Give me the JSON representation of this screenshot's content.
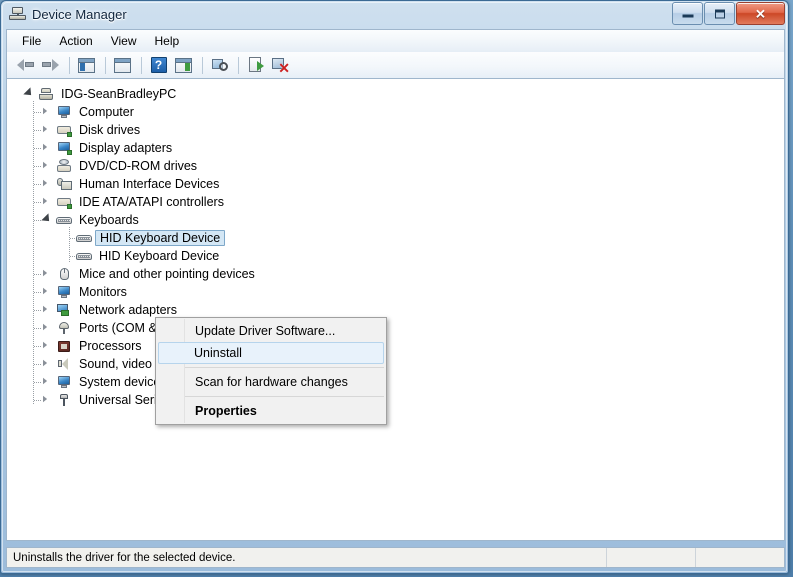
{
  "window": {
    "title": "Device Manager",
    "title_icon": "device-manager-icon",
    "buttons": {
      "minimize": "minimize-icon",
      "maximize": "maximize-icon",
      "close": "✕"
    }
  },
  "menubar": {
    "items": [
      {
        "label": "File"
      },
      {
        "label": "Action"
      },
      {
        "label": "View"
      },
      {
        "label": "Help"
      }
    ]
  },
  "toolbar": {
    "buttons": [
      {
        "name": "back-button",
        "icon": "arrow-left-icon"
      },
      {
        "name": "forward-button",
        "icon": "arrow-right-icon"
      },
      {
        "name": "show-hide-console-tree-button",
        "icon": "console-tree-icon"
      },
      {
        "name": "properties-window-button",
        "icon": "properties-window-icon"
      },
      {
        "name": "help-button",
        "icon": "question-mark-icon"
      },
      {
        "name": "show-hide-action-pane-button",
        "icon": "action-pane-icon"
      },
      {
        "name": "scan-for-hardware-changes-button",
        "icon": "scan-hardware-icon"
      },
      {
        "name": "update-driver-button",
        "icon": "update-driver-icon"
      },
      {
        "name": "uninstall-device-button",
        "icon": "uninstall-device-icon"
      }
    ]
  },
  "tree": {
    "root": {
      "label": "IDG-SeanBradleyPC",
      "icon": "computer-server-icon",
      "state": "expanded"
    },
    "nodes": [
      {
        "label": "Computer",
        "icon": "computer-icon",
        "state": "collapsed",
        "level": 1
      },
      {
        "label": "Disk drives",
        "icon": "disk-drive-icon",
        "state": "collapsed",
        "level": 1
      },
      {
        "label": "Display adapters",
        "icon": "display-adapter-icon",
        "state": "collapsed",
        "level": 1
      },
      {
        "label": "DVD/CD-ROM drives",
        "icon": "dvd-drive-icon",
        "state": "collapsed",
        "level": 1
      },
      {
        "label": "Human Interface Devices",
        "icon": "hid-icon",
        "state": "collapsed",
        "level": 1
      },
      {
        "label": "IDE ATA/ATAPI controllers",
        "icon": "ide-controller-icon",
        "state": "collapsed",
        "level": 1
      },
      {
        "label": "Keyboards",
        "icon": "keyboard-icon",
        "state": "expanded",
        "level": 1
      },
      {
        "label": "HID Keyboard Device",
        "icon": "keyboard-icon",
        "state": "leaf",
        "level": 2,
        "selected": true
      },
      {
        "label": "HID Keyboard Device",
        "icon": "keyboard-icon",
        "state": "leaf",
        "level": 2,
        "truncated": "HID Keybo"
      },
      {
        "label": "Mice and other pointing devices",
        "icon": "mouse-icon",
        "state": "collapsed",
        "level": 1,
        "truncated": "Mice and othe"
      },
      {
        "label": "Monitors",
        "icon": "monitor-icon",
        "state": "collapsed",
        "level": 1
      },
      {
        "label": "Network adapters",
        "icon": "network-adapter-icon",
        "state": "collapsed",
        "level": 1,
        "truncated": "Network adapt"
      },
      {
        "label": "Ports (COM & LPT)",
        "icon": "port-icon",
        "state": "collapsed",
        "level": 1,
        "truncated": "Ports (COM &"
      },
      {
        "label": "Processors",
        "icon": "processor-icon",
        "state": "collapsed",
        "level": 1
      },
      {
        "label": "Sound, video and game controllers",
        "icon": "sound-icon",
        "state": "collapsed",
        "level": 1
      },
      {
        "label": "System devices",
        "icon": "system-device-icon",
        "state": "collapsed",
        "level": 1
      },
      {
        "label": "Universal Serial Bus controllers",
        "icon": "usb-icon",
        "state": "collapsed",
        "level": 1
      }
    ]
  },
  "context_menu": {
    "items": [
      {
        "label": "Update Driver Software...",
        "highlighted": false,
        "bold": false
      },
      {
        "label": "Uninstall",
        "highlighted": true,
        "bold": false
      },
      {
        "label": "Scan for hardware changes",
        "highlighted": false,
        "bold": false
      },
      {
        "label": "Properties",
        "highlighted": false,
        "bold": true
      }
    ]
  },
  "statusbar": {
    "text": "Uninstalls the driver for the selected device."
  },
  "colors": {
    "selection_fill": "#d4e7f5",
    "selection_border": "#7ea8c9",
    "menu_highlight": "#e8f2fb",
    "titlebar_blue": "#79a6cb",
    "close_red": "#cc4726"
  }
}
